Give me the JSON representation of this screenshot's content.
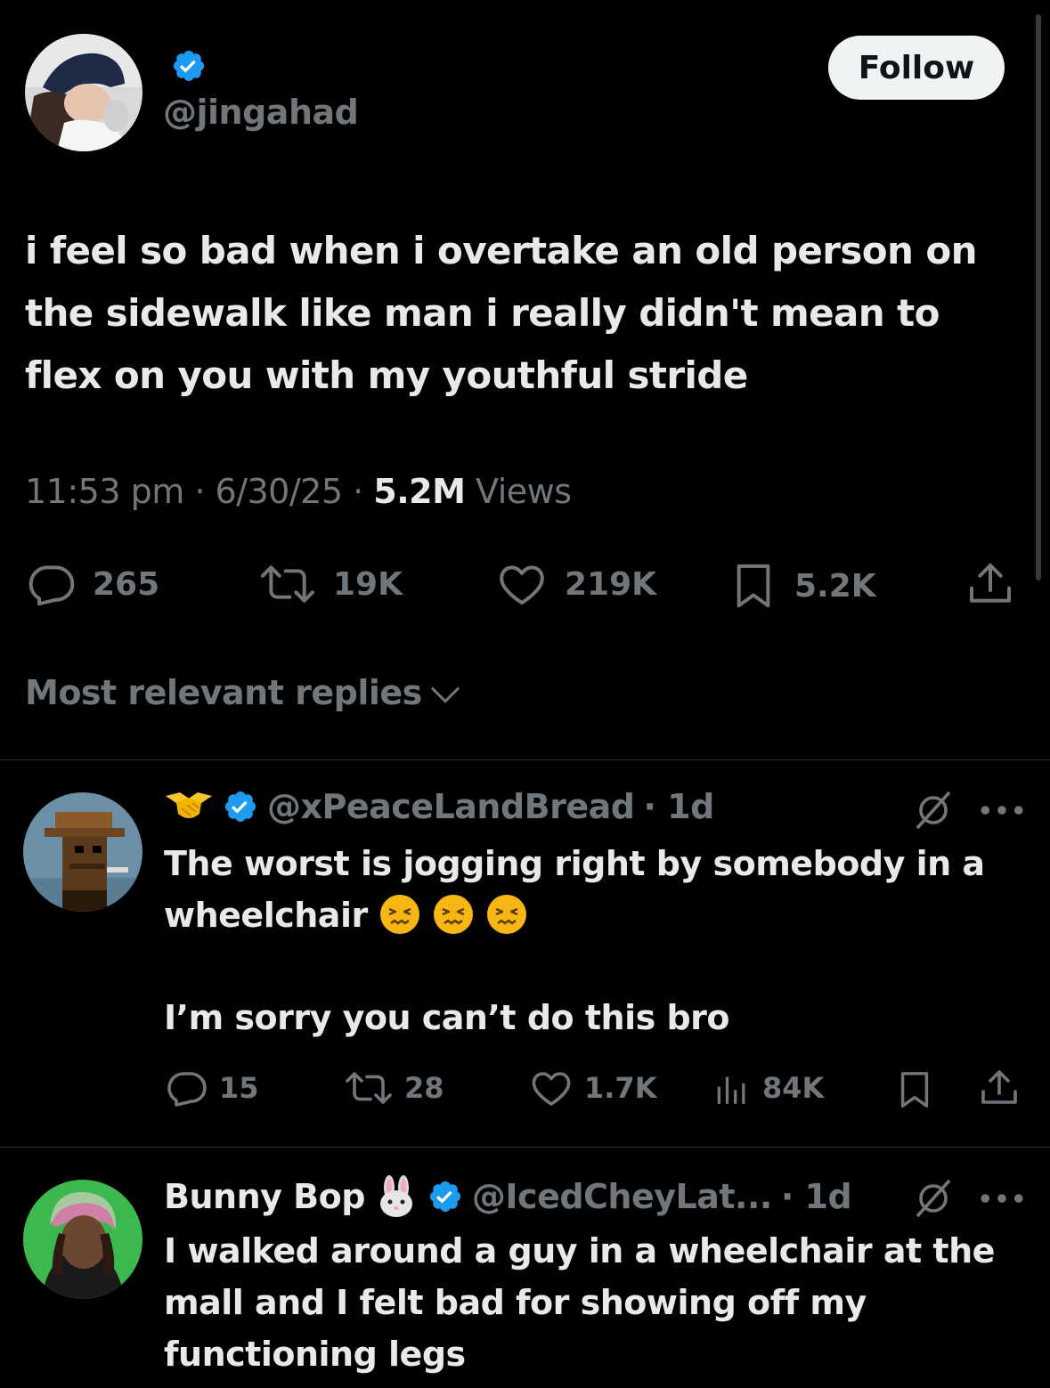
{
  "tweet": {
    "handle": "@jingahad",
    "follow_label": "Follow",
    "text": "i feel so bad when i overtake an old person on the sidewalk like man i really didn't mean to flex on you with my youthful stride",
    "time": "11:53 pm",
    "date": "6/30/25",
    "views_count": "5.2M",
    "views_label": "Views",
    "separator": "·",
    "stats": {
      "replies": "265",
      "reposts": "19K",
      "likes": "219K",
      "bookmarks": "5.2K"
    }
  },
  "replies_sort_label": "Most relevant replies",
  "replies": [
    {
      "handle": "@xPeaceLandBread",
      "time": "· 1d",
      "text_line1": "The worst is jogging right by somebody in a wheelchair",
      "text_line2": "I’m sorry you can’t do this bro",
      "stats": {
        "replies": "15",
        "reposts": "28",
        "likes": "1.7K",
        "views": "84K"
      }
    },
    {
      "name": "Bunny Bop",
      "handle": "@IcedCheyLat...",
      "time": "· 1d",
      "text": "I walked around a guy in a wheelchair at the mall and I felt bad for showing off my functioning legs"
    }
  ],
  "colors": {
    "background": "#000000",
    "text": "#e7e9ea",
    "secondary": "#71767b",
    "verified": "#1d9bf0",
    "follow_bg": "#eff3f4"
  },
  "icons": [
    "verified-badge-icon",
    "reply-icon",
    "repost-icon",
    "like-icon",
    "bookmark-icon",
    "share-icon",
    "chevron-down-icon",
    "grok-icon",
    "more-icon",
    "views-icon",
    "handshake-emoji",
    "confounded-emoji",
    "rabbit-emoji"
  ]
}
